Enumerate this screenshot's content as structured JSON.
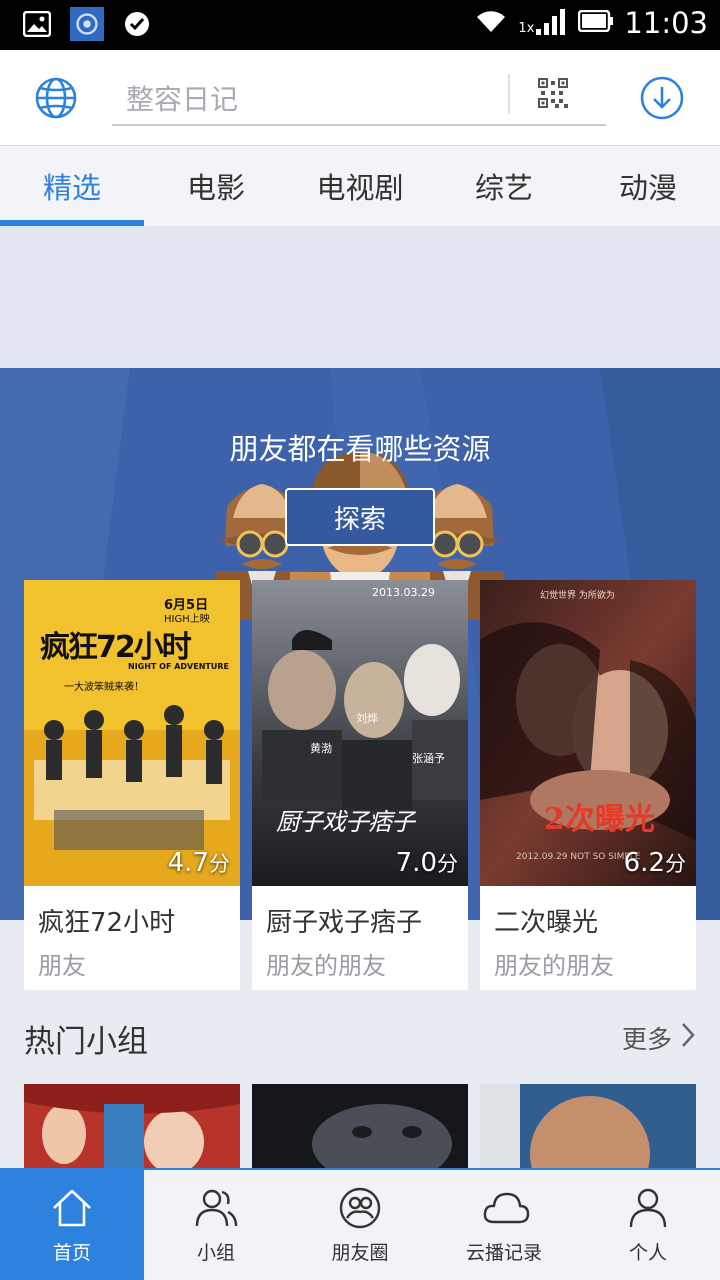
{
  "status_bar": {
    "time": "11:03",
    "signal_label": "1x",
    "icons": [
      "image-icon",
      "app-icon",
      "check-icon",
      "wifi-icon",
      "signal-icon",
      "battery-icon"
    ]
  },
  "header": {
    "search_placeholder": "整容日记",
    "icons": [
      "globe-icon",
      "qr-code-icon",
      "download-icon"
    ]
  },
  "tabs": [
    {
      "label": "精选",
      "active": true
    },
    {
      "label": "电影",
      "active": false
    },
    {
      "label": "电视剧",
      "active": false
    },
    {
      "label": "综艺",
      "active": false
    },
    {
      "label": "动漫",
      "active": false
    }
  ],
  "hero": {
    "title": "朋友都在看哪些资源",
    "button_label": "探索"
  },
  "movies": [
    {
      "title": "疯狂72小时",
      "subtitle": "朋友",
      "score": "4.7",
      "score_unit": "分",
      "poster_text": "疯狂72小时",
      "poster_date": "6月5日",
      "poster_release": "HIGH上映",
      "poster_english": "NIGHT OF ADVENTURE",
      "poster_tagline": "一大波笨贼来袭！"
    },
    {
      "title": "厨子戏子痞子",
      "subtitle": "朋友的朋友",
      "score": "7.0",
      "score_unit": "分",
      "poster_text": "厨子戏子痞子",
      "poster_date": "2013.03.29",
      "poster_cast": [
        "黄渤",
        "刘烨",
        "张涵予"
      ]
    },
    {
      "title": "二次曝光",
      "subtitle": "朋友的朋友",
      "score": "6.2",
      "score_unit": "分",
      "poster_text": "2次曝光",
      "poster_tagline": "幻觉世界  为所欲为",
      "poster_date": "2012.09.29 NOT SO SIMPLE"
    }
  ],
  "hot_groups": {
    "title": "热门小组",
    "more_label": "更多"
  },
  "bottom_nav": [
    {
      "label": "首页",
      "icon": "home-icon",
      "active": true
    },
    {
      "label": "小组",
      "icon": "group-icon",
      "active": false
    },
    {
      "label": "朋友圈",
      "icon": "friends-circle-icon",
      "active": false
    },
    {
      "label": "云播记录",
      "icon": "cloud-icon",
      "active": false
    },
    {
      "label": "个人",
      "icon": "person-icon",
      "active": false
    }
  ],
  "colors": {
    "accent": "#2d82de",
    "hero_blue": "#3d62a9",
    "page_bg": "#e9ebf2"
  }
}
